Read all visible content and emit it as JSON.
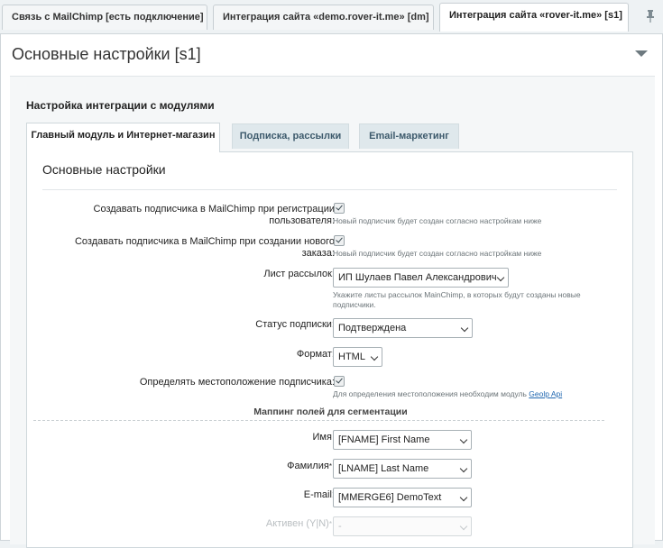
{
  "top_tabs": [
    {
      "label": "Связь с MailChimp [есть подключение]",
      "active": false
    },
    {
      "label": "Интеграция сайта «demo.rover-it.me» [dm]",
      "active": false
    },
    {
      "label": "Интеграция сайта «rover-it.me» [s1]",
      "active": true
    }
  ],
  "pin_icon": "pin-icon",
  "card": {
    "title": "Основные настройки [s1]",
    "section_title": "Настройка интеграции с модулями",
    "module_tabs": [
      {
        "label": "Главный модуль и Интернет-магазин",
        "active": true
      },
      {
        "label": "Подписка, рассылки",
        "active": false
      },
      {
        "label": "Email-маркетинг",
        "active": false
      }
    ],
    "panel_title": "Основные настройки"
  },
  "form": {
    "create_on_register": {
      "label_line1": "Создавать подписчика в MailChimp при регистрации",
      "label_line2": "пользователя:",
      "checked": true,
      "hint": "Новый подписчик будет создан согласно настройкам ниже"
    },
    "create_on_order": {
      "label_line1": "Создавать подписчика в MailChimp при создании нового",
      "label_line2": "заказа:",
      "checked": true,
      "hint": "Новый подписчик будет создан согласно настройкам ниже"
    },
    "mailing_list": {
      "label": "Лист рассылок:",
      "value": "ИП Шулаев Павел Александрович",
      "hint_line1": "Укажите листы рассылок MainChimp, в которых будут созданы новые",
      "hint_line2": "подписчики."
    },
    "subscription_status": {
      "label": "Статус подписки:",
      "value": "Подтверждена"
    },
    "format": {
      "label": "Формат:",
      "value": "HTML"
    },
    "detect_location": {
      "label": "Определять местоположение подписчика:",
      "checked": true,
      "hint_prefix": "Для определения местоположения необходим модуль ",
      "hint_link": "Geolp Api"
    },
    "mapping_heading": "Маппинг полей для сегментации",
    "mapping": {
      "name": {
        "label": "Имя:",
        "value": "[FNAME] First Name"
      },
      "surname": {
        "label": "Фамилия",
        "required_mark": "*",
        "colon": ":",
        "value": "[LNAME] Last Name"
      },
      "email": {
        "label": "E-mail:",
        "value": "[MMERGE6] DemoText"
      },
      "active": {
        "label": "Активен (Y|N)",
        "required_mark": "*",
        "colon": ":",
        "value": "-"
      }
    }
  },
  "colors": {
    "accent_link": "#2067b0",
    "tab_inactive_bg": "#dfe8ec",
    "tab_inactive_text": "#3d5a6c"
  }
}
